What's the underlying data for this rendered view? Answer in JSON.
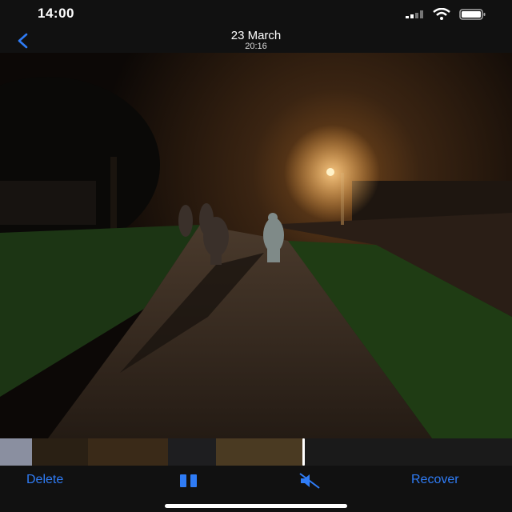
{
  "status_bar": {
    "time": "14:00",
    "icons": [
      "cellular-signal-icon",
      "wifi-icon",
      "battery-icon"
    ]
  },
  "nav_bar": {
    "back_icon": "chevron-left-icon",
    "date": "23 March",
    "time": "20:16"
  },
  "media": {
    "kind": "video",
    "scrubber_position": 0.6
  },
  "toolbar": {
    "delete_label": "Delete",
    "pause_icon": "pause-icon",
    "mute_icon": "speaker-muted-icon",
    "recover_label": "Recover"
  },
  "colors": {
    "accent": "#2f7cf6",
    "bar_background": "#111111"
  }
}
